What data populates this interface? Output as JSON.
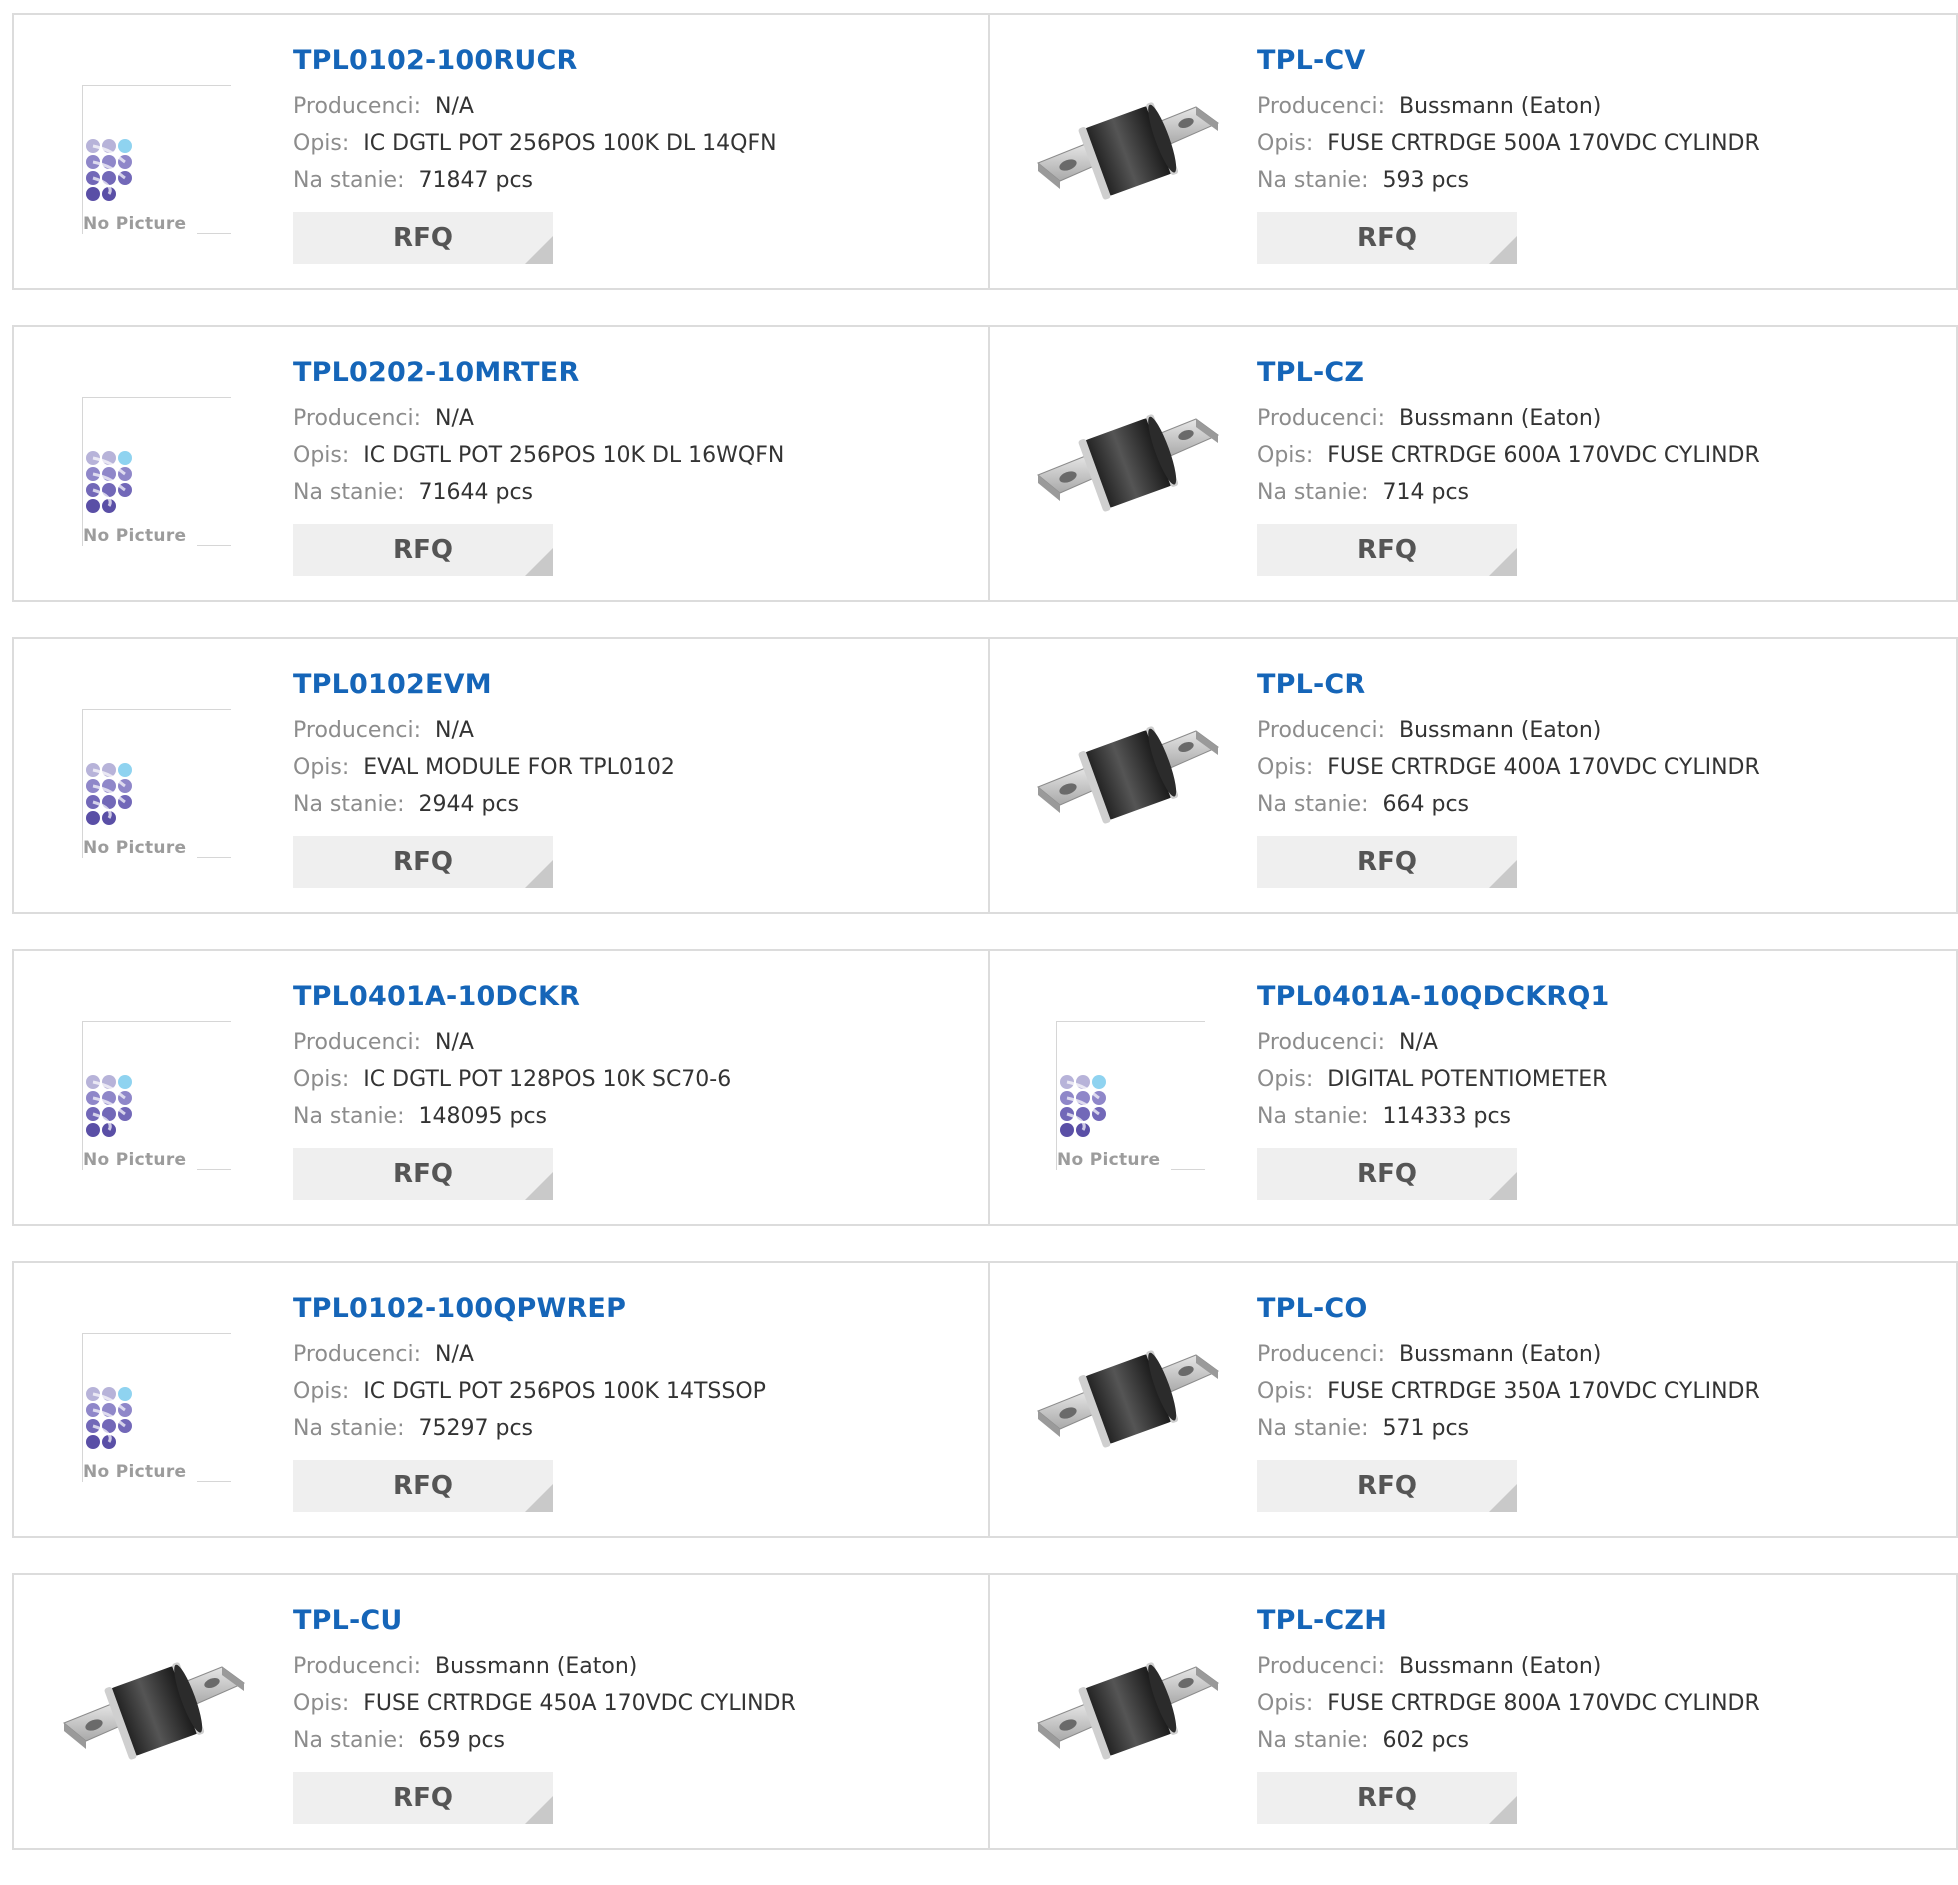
{
  "labels": {
    "manufacturer": "Producenci:",
    "description": "Opis:",
    "stock": "Na stanie:",
    "rfq": "RFQ",
    "no_picture": "No Picture"
  },
  "rows": [
    [
      {
        "part": "TPL0102-100RUCR",
        "manufacturer": "N/A",
        "description": "IC DGTL POT 256POS 100K DL 14QFN",
        "stock": "71847 pcs",
        "image": "no-picture"
      },
      {
        "part": "TPL-CV",
        "manufacturer": "Bussmann (Eaton)",
        "description": "FUSE CRTRDGE 500A 170VDC CYLINDR",
        "stock": "593 pcs",
        "image": "fuse"
      }
    ],
    [
      {
        "part": "TPL0202-10MRTER",
        "manufacturer": "N/A",
        "description": "IC DGTL POT 256POS 10K DL 16WQFN",
        "stock": "71644 pcs",
        "image": "no-picture"
      },
      {
        "part": "TPL-CZ",
        "manufacturer": "Bussmann (Eaton)",
        "description": "FUSE CRTRDGE 600A 170VDC CYLINDR",
        "stock": "714 pcs",
        "image": "fuse"
      }
    ],
    [
      {
        "part": "TPL0102EVM",
        "manufacturer": "N/A",
        "description": "EVAL MODULE FOR TPL0102",
        "stock": "2944 pcs",
        "image": "no-picture"
      },
      {
        "part": "TPL-CR",
        "manufacturer": "Bussmann (Eaton)",
        "description": "FUSE CRTRDGE 400A 170VDC CYLINDR",
        "stock": "664 pcs",
        "image": "fuse"
      }
    ],
    [
      {
        "part": "TPL0401A-10DCKR",
        "manufacturer": "N/A",
        "description": "IC DGTL POT 128POS 10K SC70-6",
        "stock": "148095 pcs",
        "image": "no-picture"
      },
      {
        "part": "TPL0401A-10QDCKRQ1",
        "manufacturer": "N/A",
        "description": "DIGITAL POTENTIOMETER",
        "stock": "114333 pcs",
        "image": "no-picture"
      }
    ],
    [
      {
        "part": "TPL0102-100QPWREP",
        "manufacturer": "N/A",
        "description": "IC DGTL POT 256POS 100K 14TSSOP",
        "stock": "75297 pcs",
        "image": "no-picture"
      },
      {
        "part": "TPL-CO",
        "manufacturer": "Bussmann (Eaton)",
        "description": "FUSE CRTRDGE 350A 170VDC CYLINDR",
        "stock": "571 pcs",
        "image": "fuse"
      }
    ],
    [
      {
        "part": "TPL-CU",
        "manufacturer": "Bussmann (Eaton)",
        "description": "FUSE CRTRDGE 450A 170VDC CYLINDR",
        "stock": "659 pcs",
        "image": "fuse"
      },
      {
        "part": "TPL-CZH",
        "manufacturer": "Bussmann (Eaton)",
        "description": "FUSE CRTRDGE 800A 170VDC CYLINDR",
        "stock": "602 pcs",
        "image": "fuse"
      }
    ]
  ],
  "colors": {
    "part_link": "#1565b8",
    "label": "#8c8c8c",
    "value": "#333333",
    "rfq_bg": "#efefef",
    "border": "#dcdcdc"
  }
}
